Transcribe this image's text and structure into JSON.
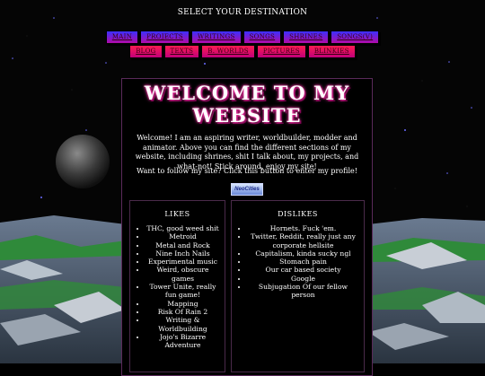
{
  "nav": {
    "title": "SELECT YOUR DESTINATION",
    "row1": [
      "MAIN",
      "PROJECTS",
      "WRITINGS",
      "SONGS",
      "SHRINES",
      "SONGS(V)"
    ],
    "row2": [
      "BLOG",
      "TEXTS",
      "B. WORLDS",
      "PICTURES",
      "BLINKIES"
    ]
  },
  "welcome": {
    "title": "WELCOME TO MY WEBSITE",
    "intro": "Welcome! I am an aspiring writer, worldbuilder, modder and animator. Above you can find the different sections of my website, including shrines, shit I talk about, my projects, and what-not! Stick around, enjoy my site!",
    "follow": "Want to follow my site? Click this button to enter my profile!",
    "badge": "NeoCities"
  },
  "likes": {
    "heading": "LIKES",
    "items": [
      "THC, good weed shit",
      "Metroid",
      "Metal and Rock",
      "Nine Inch Nails",
      "Experimental music",
      "Weird, obscure games",
      "Tower Unite, really fun game!",
      "Mapping",
      "Risk Of Rain 2",
      "Writing & Worldbuilding",
      "Jojo's Bizarre Adventure"
    ]
  },
  "dislikes": {
    "heading": "DISLIKES",
    "items": [
      "Hornets. Fuck 'em.",
      "Twitter, Reddit, really just any corporate hellsite",
      "Capitalism, kinda sucky ngl",
      "Stomach pain",
      "Our car based society",
      "Google",
      "Subjugation Of our fellow person"
    ]
  },
  "colors": {
    "nav_top": "#3b2fff",
    "nav_bottom": "#ff1b52",
    "glow": "#ff3cae"
  }
}
